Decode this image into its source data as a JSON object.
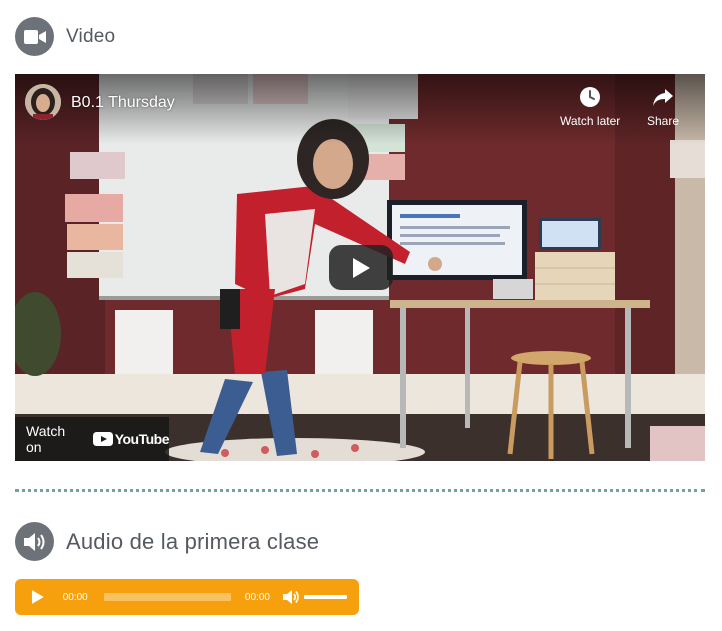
{
  "video_section": {
    "title": "Video",
    "icon": "video-camera-icon",
    "player": {
      "title": "B0.1 Thursday",
      "watch_later_label": "Watch later",
      "share_label": "Share",
      "watch_on_label": "Watch on",
      "youtube_label": "YouTube",
      "icons": [
        "channel-avatar",
        "clock-icon",
        "share-arrow-icon",
        "play-icon",
        "youtube-logo-icon"
      ]
    }
  },
  "audio_section": {
    "title": "Audio de la primera clase",
    "icon": "speaker-icon",
    "player": {
      "current_time": "00:00",
      "duration": "00:00",
      "progress": 0,
      "volume": 1,
      "accent_color": "#f7a00d"
    }
  },
  "colors": {
    "icon_circle": "#6d7278",
    "divider": "#6fa3a6",
    "youtube_red": "#ff0000"
  }
}
